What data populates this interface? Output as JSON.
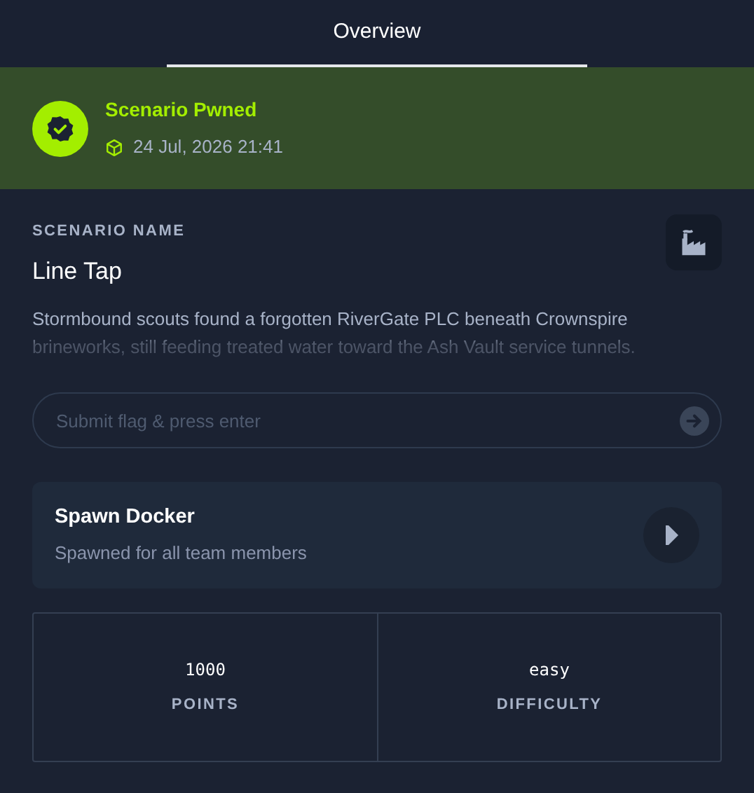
{
  "tabs": [
    {
      "label": "Overview",
      "selected": true
    }
  ],
  "banner": {
    "title": "Scenario Pwned",
    "timestamp": "24 Jul, 2026 21:41"
  },
  "scenario": {
    "label": "SCENARIO NAME",
    "name": "Line Tap",
    "description": "Stormbound scouts found a forgotten RiverGate PLC beneath Crownspire brineworks, still feeding treated water toward the Ash Vault service tunnels."
  },
  "flag_field": {
    "placeholder": "Submit flag & press enter"
  },
  "docker": {
    "title": "Spawn Docker",
    "subtitle": "Spawned for all team members"
  },
  "stats": [
    {
      "value": "1000",
      "label": "POINTS"
    },
    {
      "value": "easy",
      "label": "DIFFICULTY"
    }
  ]
}
